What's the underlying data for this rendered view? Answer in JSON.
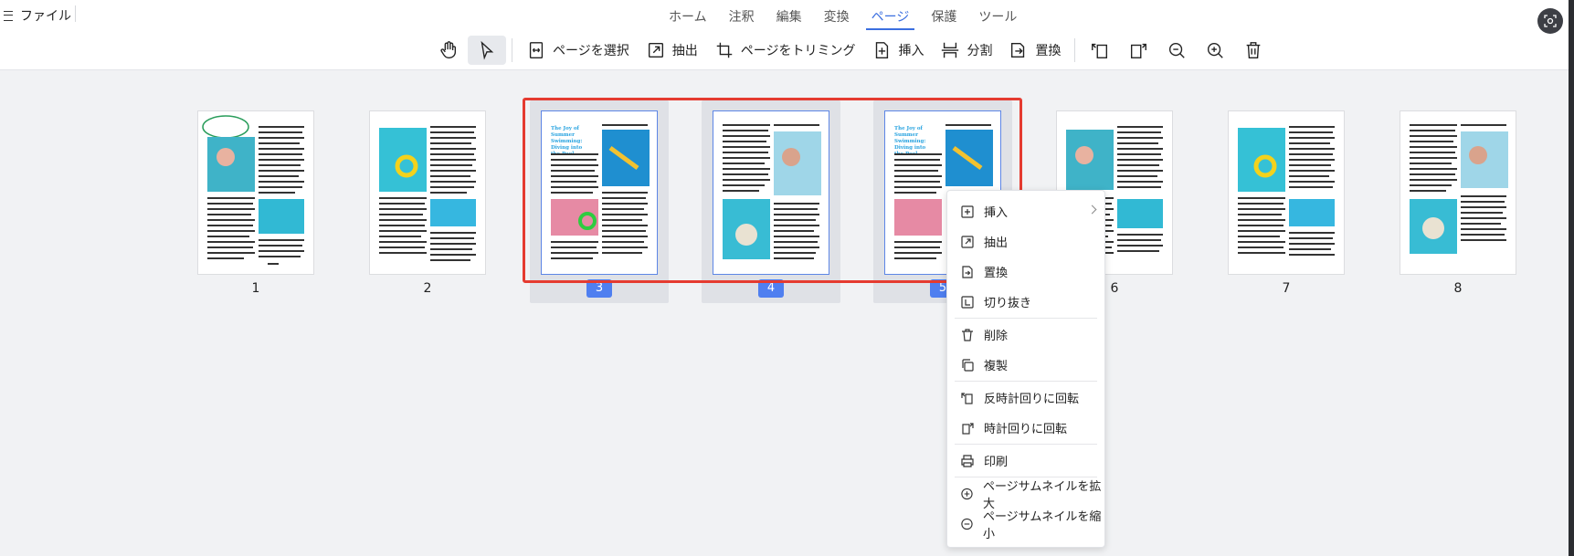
{
  "file_menu": {
    "label": "ファイル"
  },
  "menu_tabs": [
    {
      "label": "ホーム"
    },
    {
      "label": "注釈"
    },
    {
      "label": "編集"
    },
    {
      "label": "変換"
    },
    {
      "label": "ページ",
      "active": true
    },
    {
      "label": "保護"
    },
    {
      "label": "ツール"
    }
  ],
  "toolbar": {
    "select_page": "ページを選択",
    "extract": "抽出",
    "trim": "ページをトリミング",
    "insert": "挿入",
    "split": "分割",
    "replace": "置換",
    "icons": [
      "hand-icon",
      "pointer-icon",
      "rotate-ccw-icon",
      "rotate-cw-icon",
      "zoom-out-icon",
      "zoom-in-icon",
      "trash-icon"
    ]
  },
  "pages": [
    {
      "label": "1",
      "selected": false
    },
    {
      "label": "2",
      "selected": false
    },
    {
      "label": "3",
      "selected": true
    },
    {
      "label": "4",
      "selected": true
    },
    {
      "label": "5",
      "selected": true
    },
    {
      "label": "6",
      "selected": false
    },
    {
      "label": "7",
      "selected": false
    },
    {
      "label": "8",
      "selected": false
    }
  ],
  "thumb_text": {
    "title_line1": "The Joy of Summer",
    "title_line2": "Swimming: Diving into",
    "title_line3": "the Pool"
  },
  "context_menu": {
    "insert": "挿入",
    "extract": "抽出",
    "replace": "置換",
    "crop": "切り抜き",
    "delete": "削除",
    "duplicate": "複製",
    "rotate_ccw": "反時計回りに回転",
    "rotate_cw": "時計回りに回転",
    "print": "印刷",
    "zoom_in_thumbs": "ページサムネイルを拡大",
    "zoom_out_thumbs": "ページサムネイルを縮小"
  },
  "colors": {
    "accent": "#3b6fe0",
    "selection_red": "#e53b30",
    "badge": "#4f7ff0"
  }
}
